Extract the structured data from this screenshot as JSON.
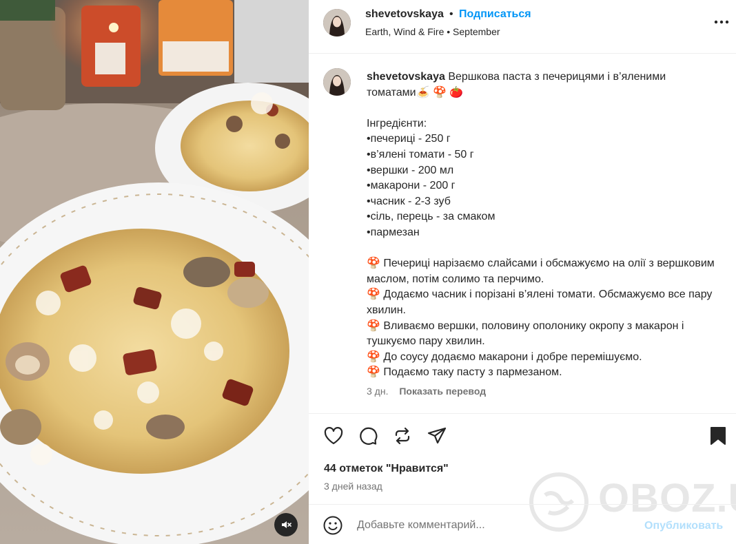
{
  "post": {
    "username": "shevetovskaya",
    "follow_label": "Подписаться",
    "separator": "•",
    "audio": "Earth, Wind & Fire • September",
    "caption_text": "Вершкова паста з печерицями і в’яленими томатами🍝 🍄 🍅\n\nІнгредієнти:\n•печериці - 250 г\n•в’ялені томати - 50 г\n•вершки - 200 мл\n•макарони - 200 г\n•часник - 2-3 зуб\n•сіль, перець - за смаком\n•пармезан\n\n🍄 Печериці нарізаємо слайсами і обсмажуємо на олії з вершковим маслом, потім солимо та перчимо.\n🍄 Додаємо часник і порізані в’ялені томати. Обсмажуємо все пару хвилин.\n🍄 Вливаємо вершки, половину ополонику окропу з макарон і тушкуємо пару хвилин.\n🍄 До соусу додаємо макарони і добре перемішуємо.\n🍄 Подаємо таку пасту з пармезаном.",
    "caption_age": "3 дн.",
    "translate_label": "Показать перевод",
    "likes": "44 отметок \"Нравится\"",
    "posted_ago": "3 дней назад",
    "comment_placeholder": "Добавьте комментарий...",
    "publish_label": "Опубликовать"
  },
  "icons": {
    "more": "more-options-icon",
    "like": "heart-icon",
    "comment": "comment-icon",
    "repost": "repost-icon",
    "share": "share-icon",
    "save": "bookmark-icon",
    "emoji": "emoji-icon",
    "mute": "muted-speaker-icon"
  },
  "watermark": {
    "text": "OBOZ.UA"
  },
  "colors": {
    "link_blue": "#0095f6",
    "publish_disabled": "#b2dffc",
    "text_primary": "#262626",
    "text_secondary": "#737373",
    "divider": "#efefef"
  }
}
